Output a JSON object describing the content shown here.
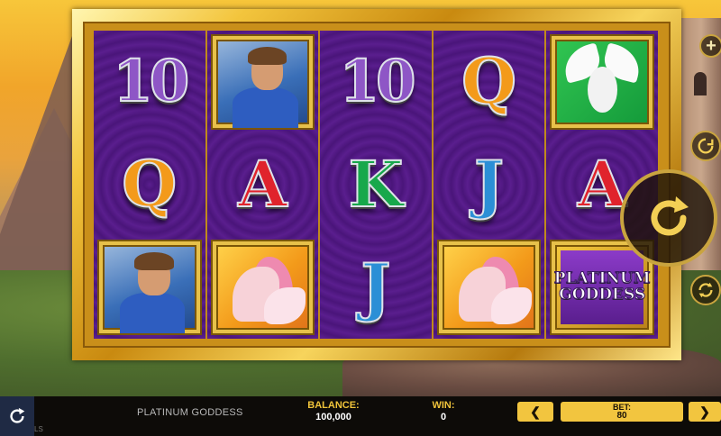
{
  "game": {
    "title": "PLATINUM GODDESS",
    "logo_line1": "PLATINUM",
    "logo_line2": "GODDESS"
  },
  "reels": [
    [
      "10",
      "goddess-man",
      "Q"
    ],
    [
      "man",
      "A",
      "horse"
    ],
    [
      "10",
      "K",
      "J"
    ],
    [
      "Q",
      "J",
      "horse"
    ],
    [
      "dove",
      "A",
      "logo"
    ]
  ],
  "symbols": {
    "ten": "10",
    "queen": "Q",
    "ace": "A",
    "king": "K",
    "jack": "J"
  },
  "status": {
    "balance_label": "BALANCE:",
    "balance_value": "100,000",
    "win_label": "WIN:",
    "win_value": "0",
    "bet_label": "BET:",
    "bet_value": "80"
  },
  "controls": {
    "prev_bet": "❮",
    "next_bet": "❯",
    "plus": "+",
    "corner_text": "LS"
  },
  "icons": {
    "spin": "spin-arrow-icon",
    "autoplay": "autoplay-icon",
    "turbo": "turbo-icon",
    "reset": "refresh-icon"
  },
  "colors": {
    "gold": "#f2c53f",
    "reel_purple": "#5a1e8e",
    "bar_bg": "#0d0b08"
  }
}
